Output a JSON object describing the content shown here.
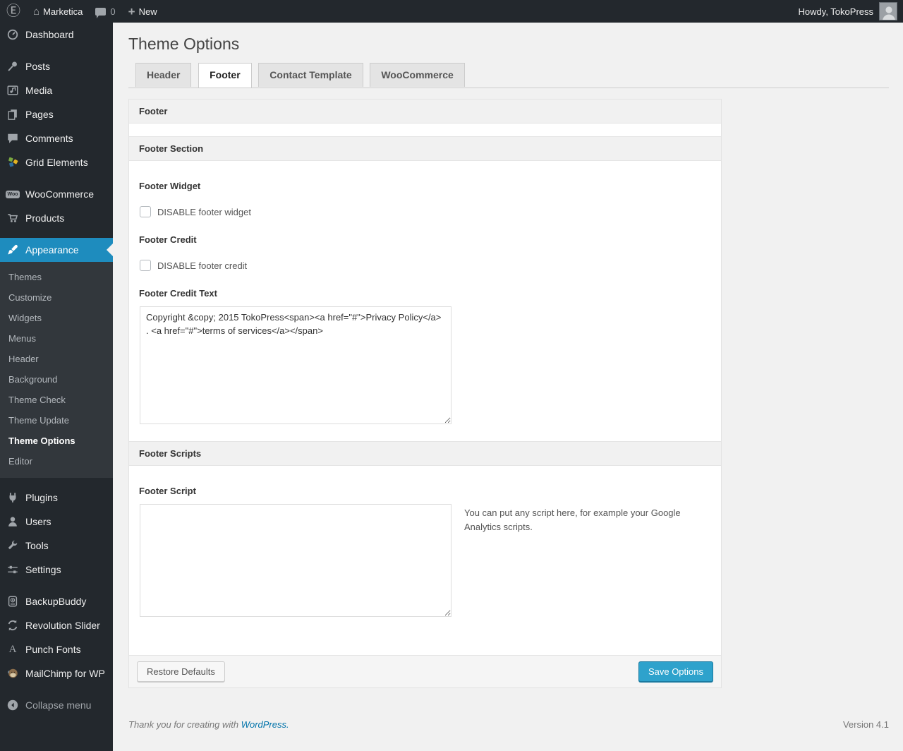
{
  "admin_bar": {
    "site_name": "Marketica",
    "comment_count": "0",
    "new_label": "New",
    "howdy": "Howdy, TokoPress"
  },
  "sidebar": {
    "dashboard": "Dashboard",
    "posts": "Posts",
    "media": "Media",
    "pages": "Pages",
    "comments": "Comments",
    "grid_elements": "Grid Elements",
    "woocommerce": "WooCommerce",
    "woo_badge": "Woo",
    "products": "Products",
    "appearance": "Appearance",
    "submenu": [
      "Themes",
      "Customize",
      "Widgets",
      "Menus",
      "Header",
      "Background",
      "Theme Check",
      "Theme Update",
      "Theme Options",
      "Editor"
    ],
    "plugins": "Plugins",
    "users": "Users",
    "tools": "Tools",
    "settings": "Settings",
    "backupbuddy": "BackupBuddy",
    "revolution_slider": "Revolution Slider",
    "punch_fonts": "Punch Fonts",
    "punch_glyph": "A",
    "mailchimp": "MailChimp for WP",
    "collapse": "Collapse menu"
  },
  "page": {
    "title": "Theme Options",
    "tabs": [
      "Header",
      "Footer",
      "Contact Template",
      "WooCommerce"
    ],
    "active_tab": "Footer"
  },
  "panel": {
    "group_header": "Footer",
    "section_header": "Footer Section",
    "footer_widget_label": "Footer Widget",
    "footer_widget_checkbox": "DISABLE footer widget",
    "footer_credit_label": "Footer Credit",
    "footer_credit_checkbox": "DISABLE footer credit",
    "footer_credit_text_label": "Footer Credit Text",
    "footer_credit_text_value": "Copyright &copy; 2015 TokoPress<span><a href=\"#\">Privacy Policy</a> . <a href=\"#\">terms of services</a></span>",
    "scripts_header": "Footer Scripts",
    "footer_script_label": "Footer Script",
    "footer_script_value": "",
    "footer_script_help": "You can put any script here, for example your Google Analytics scripts.",
    "restore_button": "Restore Defaults",
    "save_button": "Save Options"
  },
  "footer": {
    "thanks": "Thank you for creating with",
    "wordpress_link": "WordPress.",
    "version": "Version 4.1"
  },
  "colors": {
    "menu_highlight": "#1e8cbe",
    "primary_button": "#2ea2cc",
    "link": "#0073aa",
    "admin_bg": "#23282d"
  }
}
